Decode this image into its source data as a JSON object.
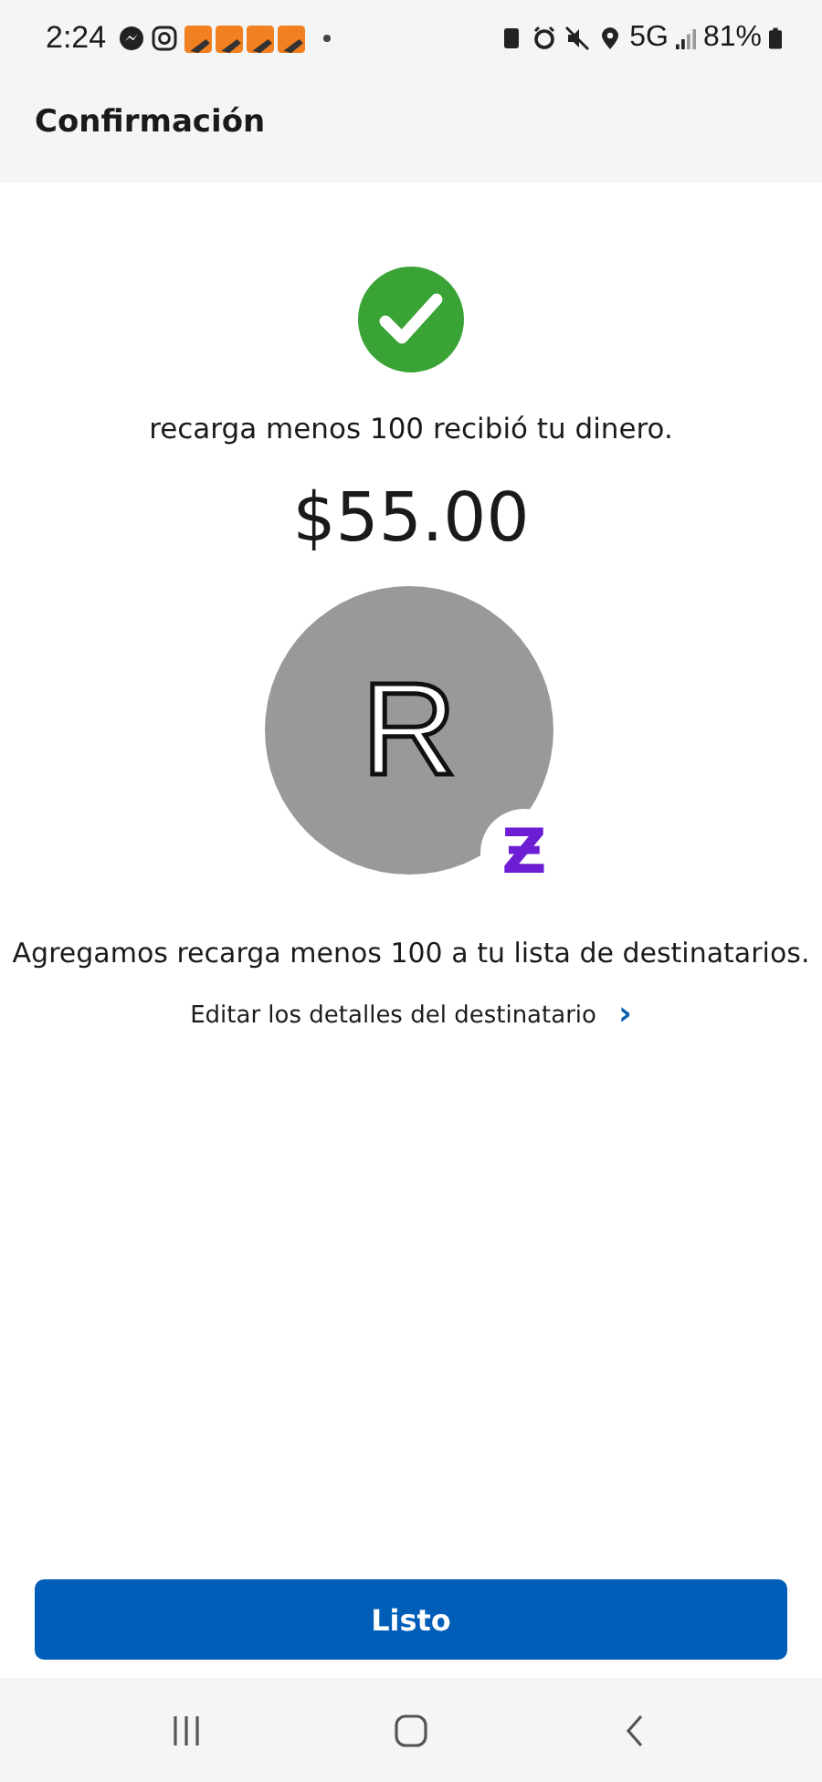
{
  "status_bar": {
    "time": "2:24",
    "network": "5G",
    "battery": "81%"
  },
  "header": {
    "title": "Confirmación"
  },
  "message": "recarga menos 100 recibió tu dinero.",
  "amount": "$55.00",
  "avatar": {
    "initial": "R",
    "badge": "Ƶ"
  },
  "note": "Agregamos recarga menos 100 a tu lista de destinatarios.",
  "edit_link": {
    "label": "Editar los detalles del destinatario",
    "arrow": "›"
  },
  "done_button": "Listo"
}
